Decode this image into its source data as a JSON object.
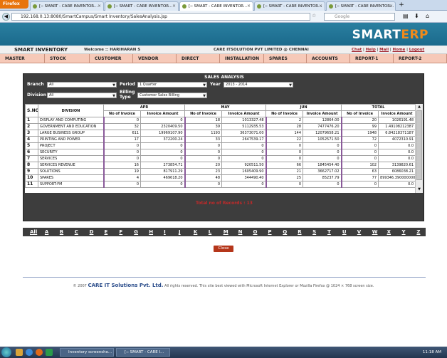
{
  "browser": {
    "firefox_label": "Firefox",
    "tabs": [
      {
        "label": "[:: SMART - CARE INVENTOR...",
        "active": false
      },
      {
        "label": "[:: SMART - CARE INVENTOR...",
        "active": false
      },
      {
        "label": "[:: SMART - CARE INVENTOR...",
        "active": true
      },
      {
        "label": "[:: SMART - CARE INVENTOR...",
        "active": false
      },
      {
        "label": "[:: SMART - CARE INVENTOR...",
        "active": false
      }
    ],
    "new_tab": "+",
    "url": "192.168.0.13:8080/SmartCampus/Smart Inventory/SalesAnalysis.jsp",
    "search_placeholder": "Google"
  },
  "app": {
    "logo_main": "SMART",
    "logo_accent": "ERP",
    "title": "SMART INVENTORY",
    "welcome": "Welcome :: HARIHARAN S",
    "company": "CARE ITSOLUTION PVT LIMITED @ CHENNAI",
    "top_links": [
      "Chat",
      "Help",
      "Mail",
      "Home",
      "Logout"
    ],
    "menu": [
      "MASTER",
      "STOCK",
      "CUSTOMER",
      "VENDOR",
      "DIRECT",
      "INSTALLATION",
      "SPARES",
      "ACCOUNTS",
      "REPORT-1",
      "REPORT-2"
    ]
  },
  "panel": {
    "title": "SALES ANALYSIS",
    "branch_label": "Branch",
    "branch_value": "All",
    "period_label": "Period",
    "period_value": "1 Quarter",
    "year_label": "Year",
    "year_value": "2013 - 2014",
    "division_label": "Division",
    "division_value": "All",
    "billing_label_1": "Billing",
    "billing_label_2": "Type",
    "billing_value": "Customer Sales Billing"
  },
  "table": {
    "sno_header": "S.NO",
    "division_header": "DIVISION",
    "month_headers": [
      "APR",
      "MAY",
      "JUN",
      "TOTAL"
    ],
    "sub_headers": [
      "No of Invoice",
      "Invoice Amount"
    ],
    "rows": [
      {
        "sno": "1",
        "division": "DISPLAY AND COMPUTING",
        "cells": [
          "0",
          "0",
          "18",
          "1013327.48",
          "2",
          "12864.00",
          "20",
          "1026191.48"
        ]
      },
      {
        "sno": "2",
        "division": "GOVERNMENT AND EDUCATION",
        "cells": [
          "32",
          "2320409.50",
          "39",
          "5112935.53",
          "28",
          "7477476.20",
          "99",
          "1.49108212387"
        ]
      },
      {
        "sno": "3",
        "division": "LARGE BUSINESS GROUP",
        "cells": [
          "611",
          "19969107.90",
          "1193",
          "36373071.00",
          "144",
          "12079658.21",
          "1948",
          "6.84218371187"
        ]
      },
      {
        "sno": "4",
        "division": "PRINTING AND POWER",
        "cells": [
          "17",
          "372200.24",
          "33",
          "2647539.17",
          "22",
          "1052571.50",
          "72",
          "4072310.91"
        ]
      },
      {
        "sno": "5",
        "division": "PROJECT",
        "cells": [
          "0",
          "0",
          "0",
          "0",
          "0",
          "0",
          "0",
          "0.0"
        ]
      },
      {
        "sno": "6",
        "division": "SECURITY",
        "cells": [
          "0",
          "0",
          "0",
          "0",
          "0",
          "0",
          "0",
          "0.0"
        ]
      },
      {
        "sno": "7",
        "division": "SERVICES",
        "cells": [
          "0",
          "0",
          "0",
          "0",
          "0",
          "0",
          "0",
          "0.0"
        ]
      },
      {
        "sno": "8",
        "division": "SERVICES REVENUE",
        "cells": [
          "16",
          "273854.71",
          "20",
          "920511.50",
          "66",
          "1845454.40",
          "102",
          "3139820.61"
        ]
      },
      {
        "sno": "9",
        "division": "SOLUTIONS",
        "cells": [
          "19",
          "817911.29",
          "23",
          "1605409.90",
          "21",
          "3662717.02",
          "63",
          "6086038.21"
        ]
      },
      {
        "sno": "10",
        "division": "SPARES",
        "cells": [
          "4",
          "469618.20",
          "48",
          "344490.40",
          "25",
          "85237.79",
          "77",
          "899346.3900000001"
        ]
      },
      {
        "sno": "11",
        "division": "SUPPORT-FM",
        "cells": [
          "0",
          "0",
          "0",
          "0",
          "0",
          "0",
          "0",
          "0.0"
        ]
      }
    ]
  },
  "records_text": "Total no of Records : 13",
  "alphabet": [
    "All",
    "A",
    "B",
    "C",
    "D",
    "E",
    "F",
    "G",
    "H",
    "I",
    "J",
    "K",
    "L",
    "M",
    "N",
    "O",
    "P",
    "Q",
    "R",
    "S",
    "T",
    "U",
    "V",
    "W",
    "X",
    "Y",
    "Z"
  ],
  "close_label": "Close",
  "footer": {
    "left": "© 2007",
    "company": "CARE IT Solutions Pvt. Ltd.",
    "right": "All rights reserved.   This site best viewed with Microsoft Internet Explorer or Mozilla Firefox @ 1024 × 768 screen size."
  },
  "taskbar": {
    "buttons": [
      "Inventory screensho...",
      "[:: SMART - CARE I..."
    ],
    "time": "11:18 AM"
  }
}
